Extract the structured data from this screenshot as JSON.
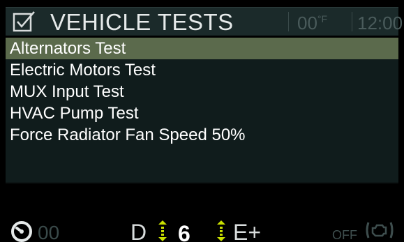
{
  "header": {
    "title": "VEHICLE TESTS",
    "temperature": "00",
    "temperature_unit": "°F",
    "clock": "12:00",
    "icon": "checkbox-icon"
  },
  "menu": {
    "selected_index": 0,
    "items": [
      {
        "label": "Alternators Test"
      },
      {
        "label": "Electric Motors Test"
      },
      {
        "label": "MUX Input Test"
      },
      {
        "label": "HVAC Pump Test"
      },
      {
        "label": "Force Radiator Fan Speed 50%"
      }
    ]
  },
  "status": {
    "speed": "00",
    "gear_mode": "D",
    "gear_number": "6",
    "economy_mode": "E+",
    "engine_state": "OFF",
    "icons": [
      "speedometer-icon",
      "gear-up-down-arrows-icon",
      "engine-icon"
    ]
  },
  "colors": {
    "background": "#000000",
    "header_bg": "#1b2a2a",
    "menu_bg": "#101c1c",
    "selected_bg": "#5b6a4c",
    "dim_text": "#4a5b5b",
    "arrow_accent": "#c9e000"
  }
}
